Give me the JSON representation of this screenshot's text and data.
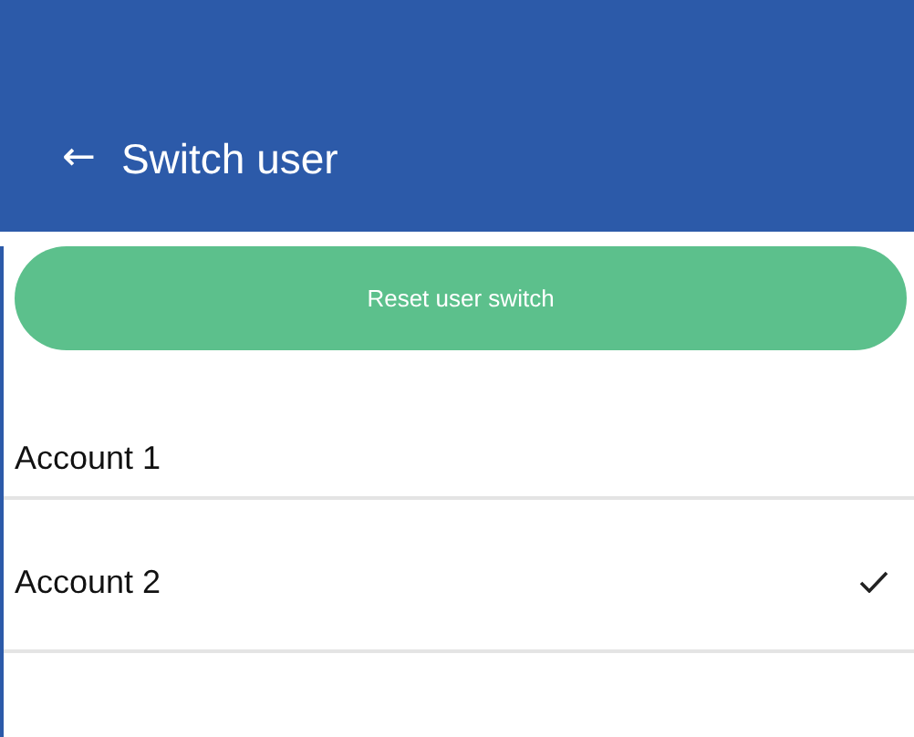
{
  "header": {
    "back": "←",
    "title": "Switch user"
  },
  "reset_button": "Reset user switch",
  "accounts": [
    {
      "name": "Account 1",
      "selected": false
    },
    {
      "name": "Account 2",
      "selected": true
    }
  ]
}
